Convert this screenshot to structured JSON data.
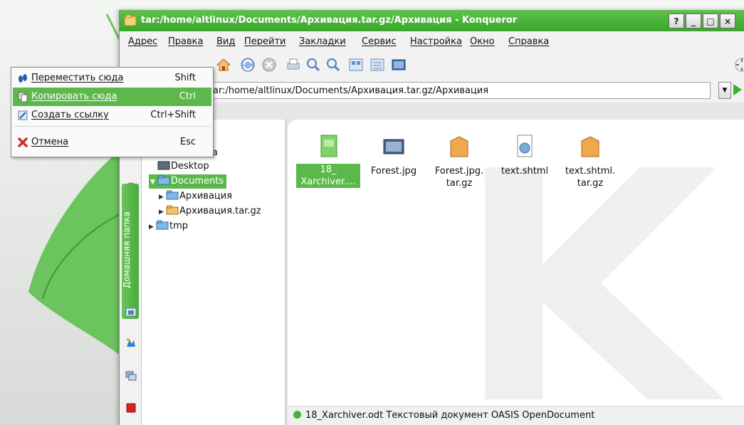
{
  "window": {
    "title": "tar:/home/altlinux/Documents/Архивация.tar.gz/Архивация - Konqueror",
    "buttons": {
      "help": "?",
      "minimize": "_",
      "maximize": "□",
      "close": "×"
    }
  },
  "menubar": [
    "Адрес",
    "Правка",
    "Вид",
    "Перейти",
    "Закладки",
    "Сервис",
    "Настройка",
    "Окно",
    "Справка"
  ],
  "toolbar": {
    "icons": [
      "home-icon",
      "reload-icon",
      "stop-icon",
      "print-icon",
      "zoom-in-icon",
      "zoom-out-icon",
      "view-mode-icon",
      "view-mode-icon",
      "preview-icon"
    ]
  },
  "location": {
    "url_partial": "ar:/home/altlinux/Documents/Архивация.tar.gz/Архивация"
  },
  "context_menu": {
    "items": [
      {
        "label": "Переместить сюда",
        "shortcut": "Shift",
        "icon": "footprints-icon"
      },
      {
        "label": "Копировать сюда",
        "shortcut": "Ctrl",
        "icon": "copy-icon",
        "highlighted": true
      },
      {
        "label": "Создать ссылку",
        "shortcut": "Ctrl+Shift",
        "icon": "link-icon"
      },
      {
        "label": "Отмена",
        "shortcut": "Esc",
        "icon": "cancel-icon"
      }
    ]
  },
  "sidebar": {
    "active_tab_label": "Домашняя папка"
  },
  "tree": {
    "partial_root": "папка",
    "items": [
      {
        "label": "Desktop"
      },
      {
        "label": "Documents",
        "selected": true
      },
      {
        "label": "Архивация"
      },
      {
        "label": "Архивация.tar.gz"
      },
      {
        "label": "tmp"
      }
    ]
  },
  "files": [
    {
      "name": "18_\nXarchiver....",
      "type": "document",
      "selected": true
    },
    {
      "name": "Forest.jpg",
      "type": "image"
    },
    {
      "name": "Forest.jpg.\ntar.gz",
      "type": "archive"
    },
    {
      "name": "text.shtml",
      "type": "web"
    },
    {
      "name": "text.shtml.\ntar.gz",
      "type": "archive"
    }
  ],
  "status": {
    "text": "18_Xarchiver.odt  Текстовый документ OASIS OpenDocument"
  },
  "colors": {
    "accent": "#5cb84b",
    "titlebar": "#3aa62c"
  }
}
